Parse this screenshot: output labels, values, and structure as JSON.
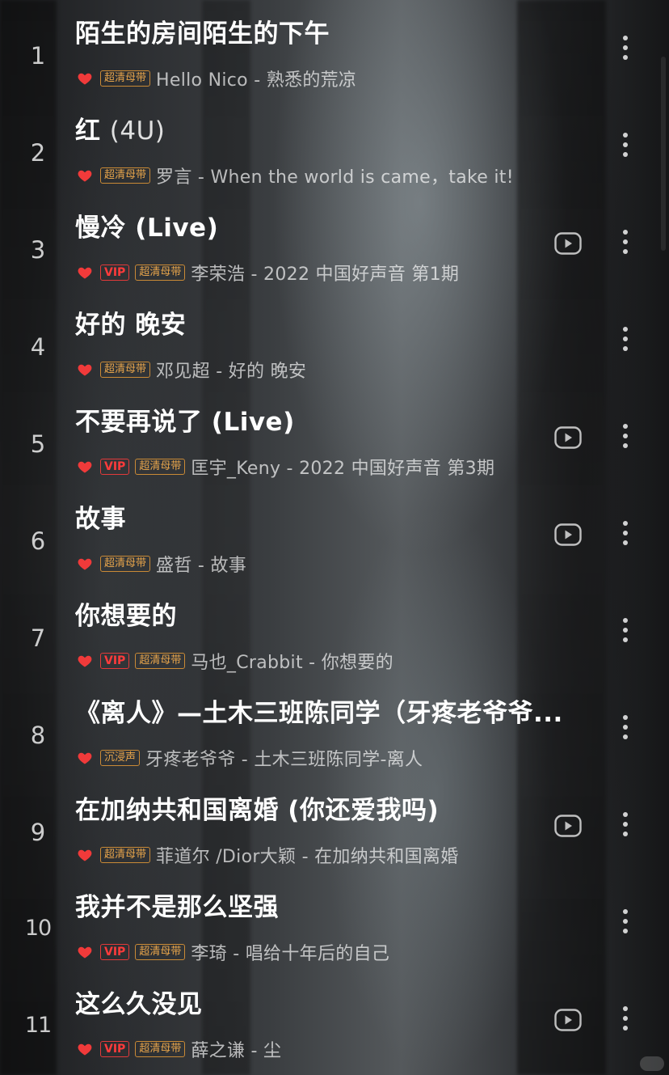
{
  "songs": [
    {
      "rank": "1",
      "title": "陌生的房间陌生的下午",
      "title_extra": "",
      "vip": false,
      "quality": "超清母带",
      "artist_line": "Hello Nico - 熟悉的荒凉",
      "has_mv": false
    },
    {
      "rank": "2",
      "title": "红",
      "title_extra": "(4U)",
      "vip": false,
      "quality": "超清母带",
      "artist_line": "罗言 - When the world is came，take it!",
      "has_mv": false
    },
    {
      "rank": "3",
      "title": "慢冷 (Live)",
      "title_extra": "",
      "vip": true,
      "quality": "超清母带",
      "artist_line": "李荣浩 - 2022 中国好声音 第1期",
      "has_mv": true
    },
    {
      "rank": "4",
      "title": "好的 晚安",
      "title_extra": "",
      "vip": false,
      "quality": "超清母带",
      "artist_line": "邓见超 - 好的 晚安",
      "has_mv": false
    },
    {
      "rank": "5",
      "title": "不要再说了 (Live)",
      "title_extra": "",
      "vip": true,
      "quality": "超清母带",
      "artist_line": "匡宇_Keny - 2022 中国好声音 第3期",
      "has_mv": true
    },
    {
      "rank": "6",
      "title": "故事",
      "title_extra": "",
      "vip": false,
      "quality": "超清母带",
      "artist_line": "盛哲 - 故事",
      "has_mv": true
    },
    {
      "rank": "7",
      "title": "你想要的",
      "title_extra": "",
      "vip": true,
      "quality": "超清母带",
      "artist_line": "马也_Crabbit - 你想要的",
      "has_mv": false
    },
    {
      "rank": "8",
      "title": "《离人》—土木三班陈同学（牙疼老爷爷...",
      "title_extra": "",
      "vip": false,
      "quality": "沉浸声",
      "artist_line": "牙疼老爷爷 - 土木三班陈同学-离人",
      "has_mv": false
    },
    {
      "rank": "9",
      "title": "在加纳共和国离婚 (你还爱我吗)",
      "title_extra": "",
      "vip": false,
      "quality": "超清母带",
      "artist_line": "菲道尔 /Dior大颖 - 在加纳共和国离婚",
      "has_mv": true
    },
    {
      "rank": "10",
      "title": "我并不是那么坚强",
      "title_extra": "",
      "vip": true,
      "quality": "超清母带",
      "artist_line": "李琦 - 唱给十年后的自己",
      "has_mv": false
    },
    {
      "rank": "11",
      "title": "这么久没见",
      "title_extra": "",
      "vip": true,
      "quality": "超清母带",
      "artist_line": "薛之谦 - 尘",
      "has_mv": true
    }
  ],
  "labels": {
    "vip": "VIP"
  },
  "colors": {
    "heart": "#f03a3a",
    "vip": "#ff3b3b",
    "quality": "#e6a44b"
  },
  "icons": {
    "favorite": "heart-icon",
    "mv": "play-video-icon",
    "more": "more-vertical-icon"
  }
}
